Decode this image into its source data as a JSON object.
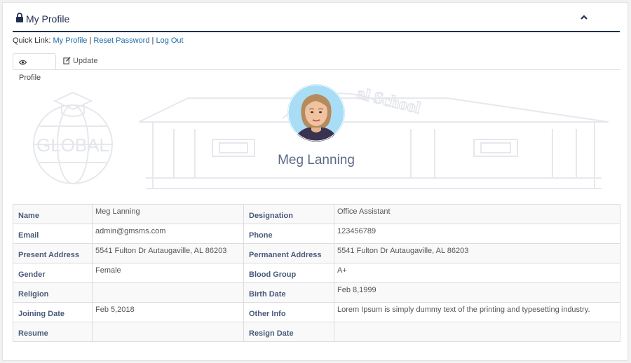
{
  "header": {
    "title": "My Profile",
    "lock_icon": "lock-icon",
    "collapse_icon": "chevron-up-icon"
  },
  "quick_links": {
    "prefix": "Quick Link:",
    "links": [
      "My Profile",
      "Reset Password",
      "Log Out"
    ],
    "separator": "|"
  },
  "tabs": [
    {
      "label": "Profile",
      "icon": "eye-icon",
      "active": true
    },
    {
      "label": "Update",
      "icon": "edit-icon",
      "active": false
    }
  ],
  "background_art": {
    "logo_text": "GLOBAL",
    "building_text": "al School"
  },
  "profile": {
    "name": "Meg Lanning"
  },
  "info_rows": [
    {
      "label1": "Name",
      "value1": "Meg Lanning",
      "label2": "Designation",
      "value2": "Office Assistant"
    },
    {
      "label1": "Email",
      "value1": "admin@gmsms.com",
      "label2": "Phone",
      "value2": "123456789"
    },
    {
      "label1": "Present Address",
      "value1": "5541 Fulton Dr Autaugaville, AL 86203",
      "label2": "Permanent Address",
      "value2": "5541 Fulton Dr Autaugaville, AL 86203"
    },
    {
      "label1": "Gender",
      "value1": "Female",
      "label2": "Blood Group",
      "value2": "A+"
    },
    {
      "label1": "Religion",
      "value1": "",
      "label2": "Birth Date",
      "value2": "Feb 8,1999"
    },
    {
      "label1": "Joining Date",
      "value1": "Feb 5,2018",
      "label2": "Other Info",
      "value2": "Lorem Ipsum is simply dummy text of the printing and typesetting industry."
    },
    {
      "label1": "Resume",
      "value1": "",
      "label2": "Resign Date",
      "value2": ""
    }
  ],
  "colors": {
    "accent": "#1f2f4f",
    "link": "#1a6aa8",
    "label": "#4a5a7a"
  }
}
